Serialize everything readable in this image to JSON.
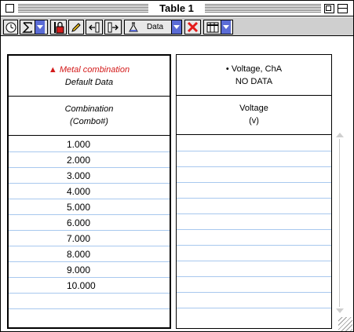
{
  "window": {
    "title": "Table 1"
  },
  "toolbar": {
    "data_label": "Data",
    "icons": [
      "clock-icon",
      "sigma-icon",
      "lock-icon",
      "pencil-icon",
      "insert-left-icon",
      "insert-right-icon",
      "lab-flask-icon",
      "delete-x-icon",
      "table-grid-icon"
    ]
  },
  "columns": [
    {
      "header_marker": "▲",
      "header_title": "Metal combination",
      "header_source": "Default Data",
      "name": "Combination",
      "units": "(Combo#)",
      "values": [
        "1.000",
        "2.000",
        "3.000",
        "4.000",
        "5.000",
        "6.000",
        "7.000",
        "8.000",
        "9.000",
        "10.000",
        ""
      ]
    },
    {
      "header_marker": "•",
      "header_title": "Voltage, ChA",
      "header_source": "NO DATA",
      "name": "Voltage",
      "units": "(v)",
      "values": [
        "",
        "",
        "",
        "",
        "",
        "",
        "",
        "",
        "",
        "",
        ""
      ]
    }
  ],
  "colors": {
    "toolbar_bg": "#cfcfcf",
    "dropdown_blue": "#5b6cd6",
    "delete_red": "#e41b1b",
    "row_line": "#a8c8ee",
    "header_red": "#d31a1a"
  }
}
